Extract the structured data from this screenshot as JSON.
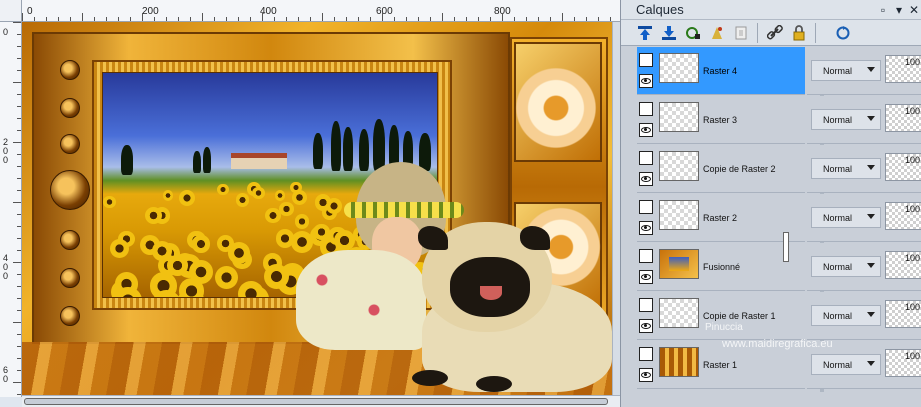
{
  "canvas": {
    "ruler_h_labels": [
      "0",
      "200",
      "400",
      "600",
      "800"
    ],
    "ruler_v_labels": [
      "0",
      "2 0 0",
      "4 0 0",
      "6 0"
    ]
  },
  "watermark": {
    "name": "Pinuccia",
    "url": "www.maidiregrafica.eu"
  },
  "palette": {
    "title": "Calques",
    "toolbar_icons": [
      "move-layer-up-icon",
      "move-layer-down-icon",
      "layer-properties-icon",
      "mask-icon",
      "merge-icon",
      "link-icon",
      "lock-icon",
      "refresh-icon"
    ],
    "layers": [
      {
        "name": "Raster 4",
        "blend": "Normal",
        "opacity": "100",
        "selected": true
      },
      {
        "name": "Raster 3",
        "blend": "Normal",
        "opacity": "100",
        "selected": false
      },
      {
        "name": "Copie de Raster 2",
        "blend": "Normal",
        "opacity": "100",
        "selected": false
      },
      {
        "name": "Raster 2",
        "blend": "Normal",
        "opacity": "100",
        "selected": false
      },
      {
        "name": "Fusionné",
        "blend": "Normal",
        "opacity": "100",
        "selected": false
      },
      {
        "name": "Copie de Raster 1",
        "blend": "Normal",
        "opacity": "100",
        "selected": false
      },
      {
        "name": "Raster 1",
        "blend": "Normal",
        "opacity": "100",
        "selected": false
      }
    ]
  }
}
